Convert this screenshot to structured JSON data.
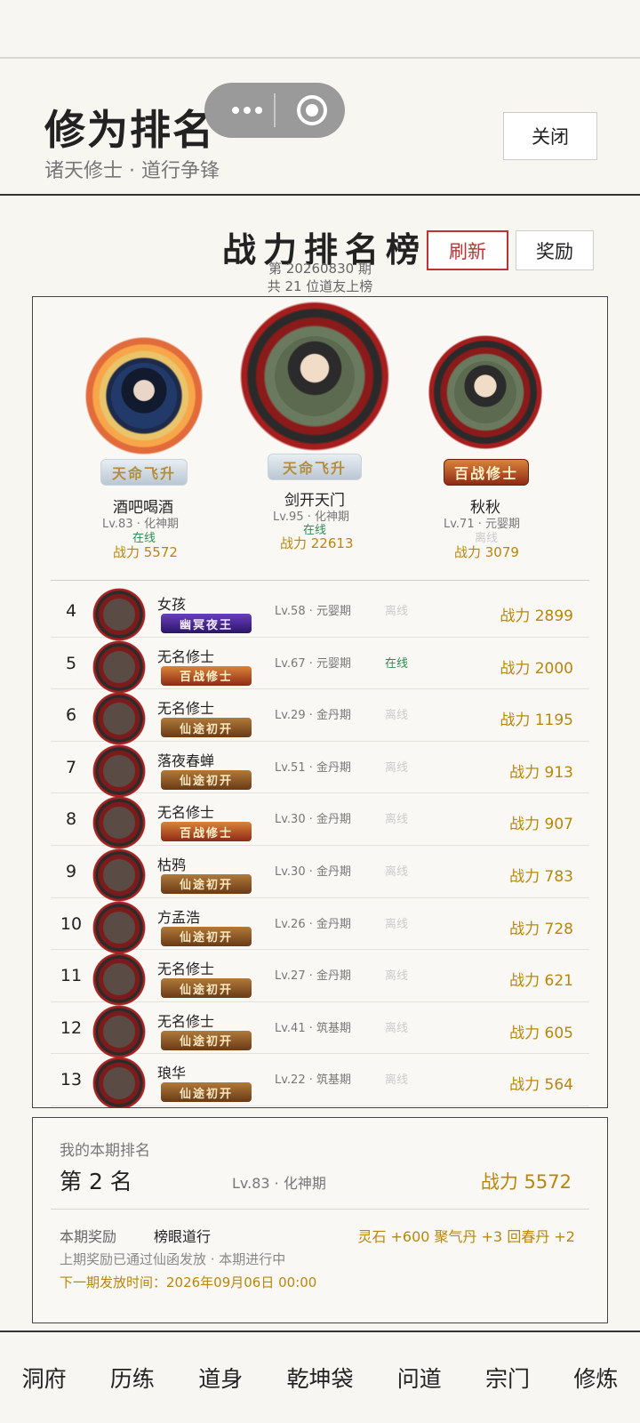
{
  "header": {
    "title": "修为排名",
    "subtitle": "诸天修士 · 道行争锋",
    "close_label": "关闭"
  },
  "board": {
    "title": "战力排名榜",
    "refresh_label": "刷新",
    "reward_label": "奖励",
    "period": "第 20260830 期",
    "count": "共 21 位道友上榜"
  },
  "podium": [
    {
      "rank": 1,
      "name": "剑开天门",
      "lv": "Lv.95 · 化神期",
      "status": "在线",
      "power": "战力 22613",
      "tag": "天命飞升"
    },
    {
      "rank": 2,
      "name": "酒吧喝酒",
      "lv": "Lv.83 · 化神期",
      "status": "在线",
      "power": "战力 5572",
      "tag": "天命飞升"
    },
    {
      "rank": 3,
      "name": "秋秋",
      "lv": "Lv.71 · 元婴期",
      "status": "离线",
      "power": "战力 3079",
      "tag": "百战修士"
    }
  ],
  "rows": [
    {
      "rank": "4",
      "name": "女孩",
      "tag": "幽冥夜王",
      "tag_style": "night",
      "lv": "Lv.58 · 元婴期",
      "status": "离线",
      "power": "战力 2899"
    },
    {
      "rank": "5",
      "name": "无名修士",
      "tag": "百战修士",
      "tag_style": "war",
      "lv": "Lv.67 · 元婴期",
      "status": "在线",
      "power": "战力 2000"
    },
    {
      "rank": "6",
      "name": "无名修士",
      "tag": "仙途初开",
      "tag_style": "init",
      "lv": "Lv.29 · 金丹期",
      "status": "离线",
      "power": "战力 1195"
    },
    {
      "rank": "7",
      "name": "落夜春蝉",
      "tag": "仙途初开",
      "tag_style": "init",
      "lv": "Lv.51 · 金丹期",
      "status": "离线",
      "power": "战力 913"
    },
    {
      "rank": "8",
      "name": "无名修士",
      "tag": "百战修士",
      "tag_style": "war",
      "lv": "Lv.30 · 金丹期",
      "status": "离线",
      "power": "战力 907"
    },
    {
      "rank": "9",
      "name": "枯鸦",
      "tag": "仙途初开",
      "tag_style": "init",
      "lv": "Lv.30 · 金丹期",
      "status": "离线",
      "power": "战力 783"
    },
    {
      "rank": "10",
      "name": "方孟浩",
      "tag": "仙途初开",
      "tag_style": "init",
      "lv": "Lv.26 · 金丹期",
      "status": "离线",
      "power": "战力 728"
    },
    {
      "rank": "11",
      "name": "无名修士",
      "tag": "仙途初开",
      "tag_style": "init",
      "lv": "Lv.27 · 金丹期",
      "status": "离线",
      "power": "战力 621"
    },
    {
      "rank": "12",
      "name": "无名修士",
      "tag": "仙途初开",
      "tag_style": "init",
      "lv": "Lv.41 · 筑基期",
      "status": "离线",
      "power": "战力 605"
    },
    {
      "rank": "13",
      "name": "琅华",
      "tag": "仙途初开",
      "tag_style": "init",
      "lv": "Lv.22 · 筑基期",
      "status": "离线",
      "power": "战力 564"
    }
  ],
  "my_rank": {
    "label": "我的本期排名",
    "rank": "第 2 名",
    "lv": "Lv.83 · 化神期",
    "power": "战力 5572",
    "reward_label": "本期奖励",
    "reward_name": "榜眼道行",
    "reward_items": "灵石 +600  聚气丹 +3  回春丹 +2",
    "notice": "上期奖励已通过仙函发放 · 本期进行中",
    "next_time": "下一期发放时间：2026年09月06日 00:00"
  },
  "nav": [
    "洞府",
    "历练",
    "道身",
    "乾坤袋",
    "问道",
    "宗门",
    "修炼"
  ]
}
